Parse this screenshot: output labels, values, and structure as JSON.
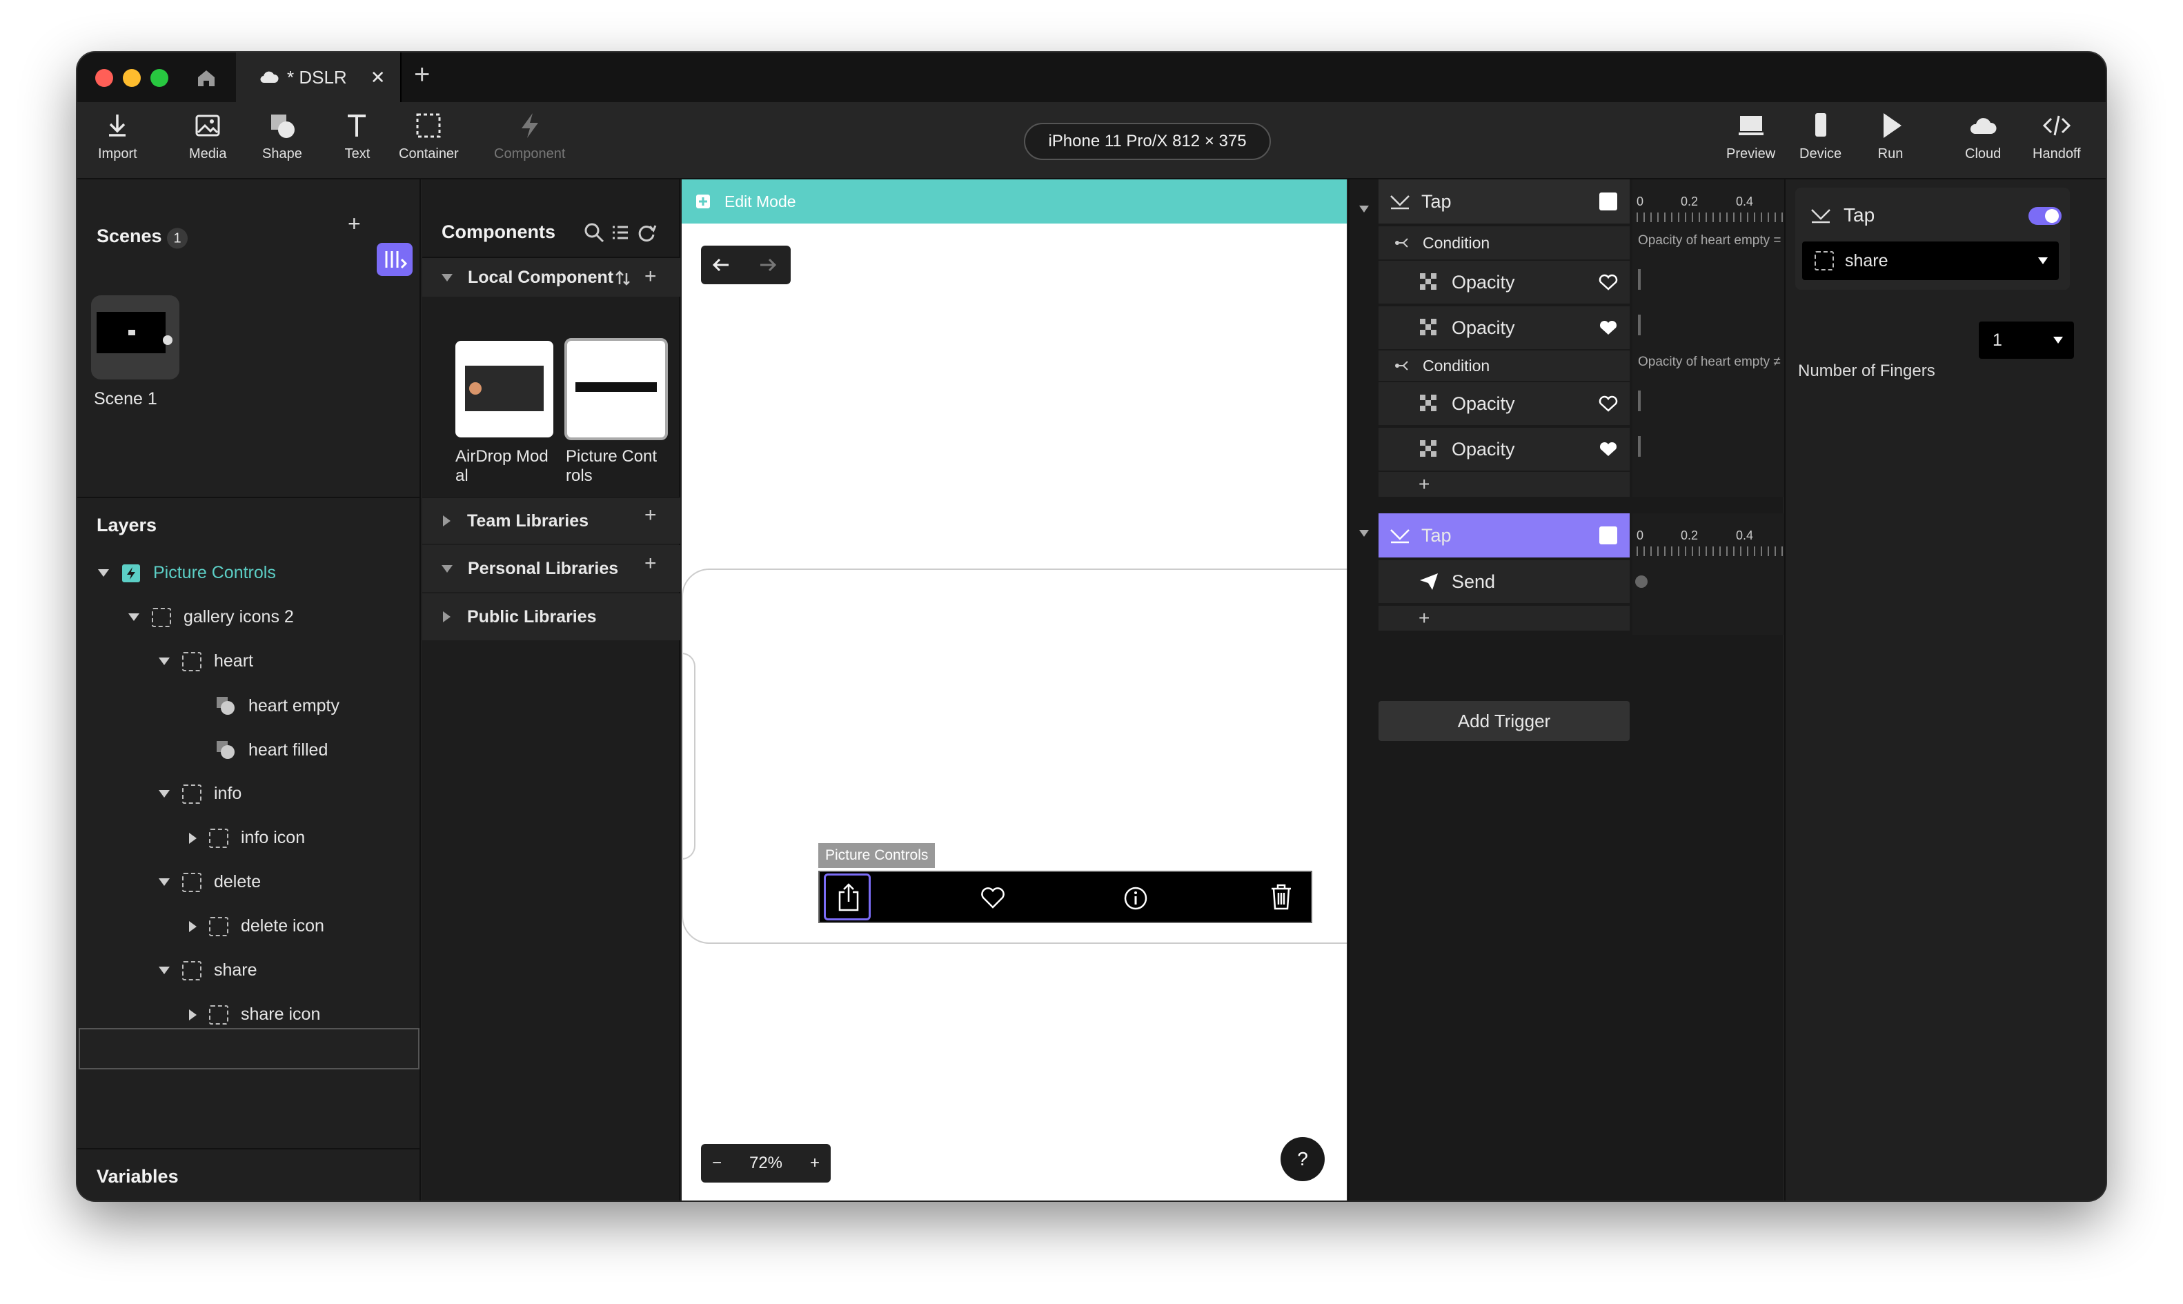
{
  "window": {
    "tab_title": "* DSLR"
  },
  "toolbar": {
    "tools": [
      "Import",
      "Media",
      "Shape",
      "Text",
      "Container",
      "Component"
    ],
    "device": "iPhone 11 Pro/X  812 × 375",
    "right_tools": [
      "Preview",
      "Device",
      "Run",
      "Cloud",
      "Handoff"
    ]
  },
  "scenes": {
    "title": "Scenes",
    "count": "1",
    "scene_name": "Scene 1"
  },
  "layers": {
    "title": "Layers",
    "items": [
      {
        "label": "Picture Controls"
      },
      {
        "label": "gallery icons 2"
      },
      {
        "label": "heart"
      },
      {
        "label": "heart empty"
      },
      {
        "label": "heart filled"
      },
      {
        "label": "info"
      },
      {
        "label": "info icon"
      },
      {
        "label": "delete"
      },
      {
        "label": "delete icon"
      },
      {
        "label": "share"
      },
      {
        "label": "share icon"
      }
    ]
  },
  "variables": {
    "title": "Variables"
  },
  "components": {
    "title": "Components",
    "local": "Local Component",
    "cards": [
      "AirDrop Mod\nal",
      "Picture Cont\nrols"
    ],
    "libraries": [
      "Team Libraries",
      "Personal Libraries",
      "Public Libraries"
    ]
  },
  "canvas": {
    "edit_mode": "Edit Mode",
    "component_label": "Picture Controls",
    "zoom": "72%",
    "help": "?"
  },
  "interactions": {
    "trigger1": {
      "name": "Tap",
      "conditions": [
        {
          "label": "Condition",
          "note": "Opacity of heart empty =",
          "actions": [
            "Opacity",
            "Opacity"
          ]
        },
        {
          "label": "Condition",
          "note": "Opacity of heart empty ≠",
          "actions": [
            "Opacity",
            "Opacity"
          ]
        }
      ]
    },
    "trigger2": {
      "name": "Tap",
      "action": "Send"
    },
    "add_trigger": "Add Trigger",
    "ruler_ticks": [
      "0",
      "0.2",
      "0.4"
    ]
  },
  "inspector": {
    "trigger": "Tap",
    "target": "share",
    "fingers_label": "Number of Fingers",
    "fingers_value": "1"
  },
  "colors": {
    "accent": "#7b6cf6",
    "edit_bar": "#5ccfc6",
    "tap_active": "#8b7cf8"
  }
}
